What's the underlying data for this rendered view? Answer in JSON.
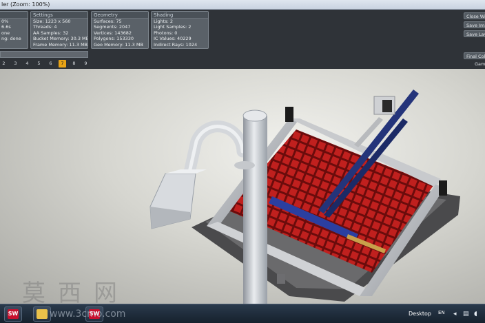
{
  "window": {
    "title": "ler (Zoom: 100%)"
  },
  "panels": [
    {
      "id": "status",
      "header": "",
      "lines": [
        "0%",
        "6.6s",
        "one",
        "ng: done"
      ]
    },
    {
      "id": "settings",
      "header": "Settings",
      "lines": [
        "Size: 1223 x 560",
        "Threads: 4",
        "AA Samples: 32",
        "Bucket Memory: 30.3 MB",
        "Frame Memory: 11.3 MB"
      ]
    },
    {
      "id": "geometry",
      "header": "Geometry",
      "lines": [
        "Surfaces: 75",
        "Segments: 2047",
        "Vertices: 143682",
        "Polygons: 153330",
        "Geo Memory: 11.3 MB"
      ]
    },
    {
      "id": "shading",
      "header": "Shading",
      "lines": [
        "Lights: 2",
        "Light Samples: 2",
        "Photons: 0",
        "IC Values: 40229",
        "Indirect Rays: 1024"
      ]
    }
  ],
  "pages": [
    "2",
    "3",
    "4",
    "5",
    "6",
    "7",
    "8",
    "9"
  ],
  "active_page": "7",
  "buttons": {
    "close_window": "Close Win",
    "save_image": "Save Imag",
    "save_layers": "Save Laye",
    "final_color": "Final Colo",
    "gamma": "Gamm"
  },
  "taskbar": {
    "desktop": "Desktop",
    "lang": "EN",
    "app1": "SW",
    "app3": "SW"
  },
  "watermark": {
    "text": "莫西网",
    "url": "www.3cmo.com"
  },
  "colors": {
    "panel_bg": "#2f3338",
    "box_bg": "#5a6168",
    "active_page": "#e8a316",
    "tray_red": "#c8102e",
    "frame_blue": "#1e2e6e"
  }
}
